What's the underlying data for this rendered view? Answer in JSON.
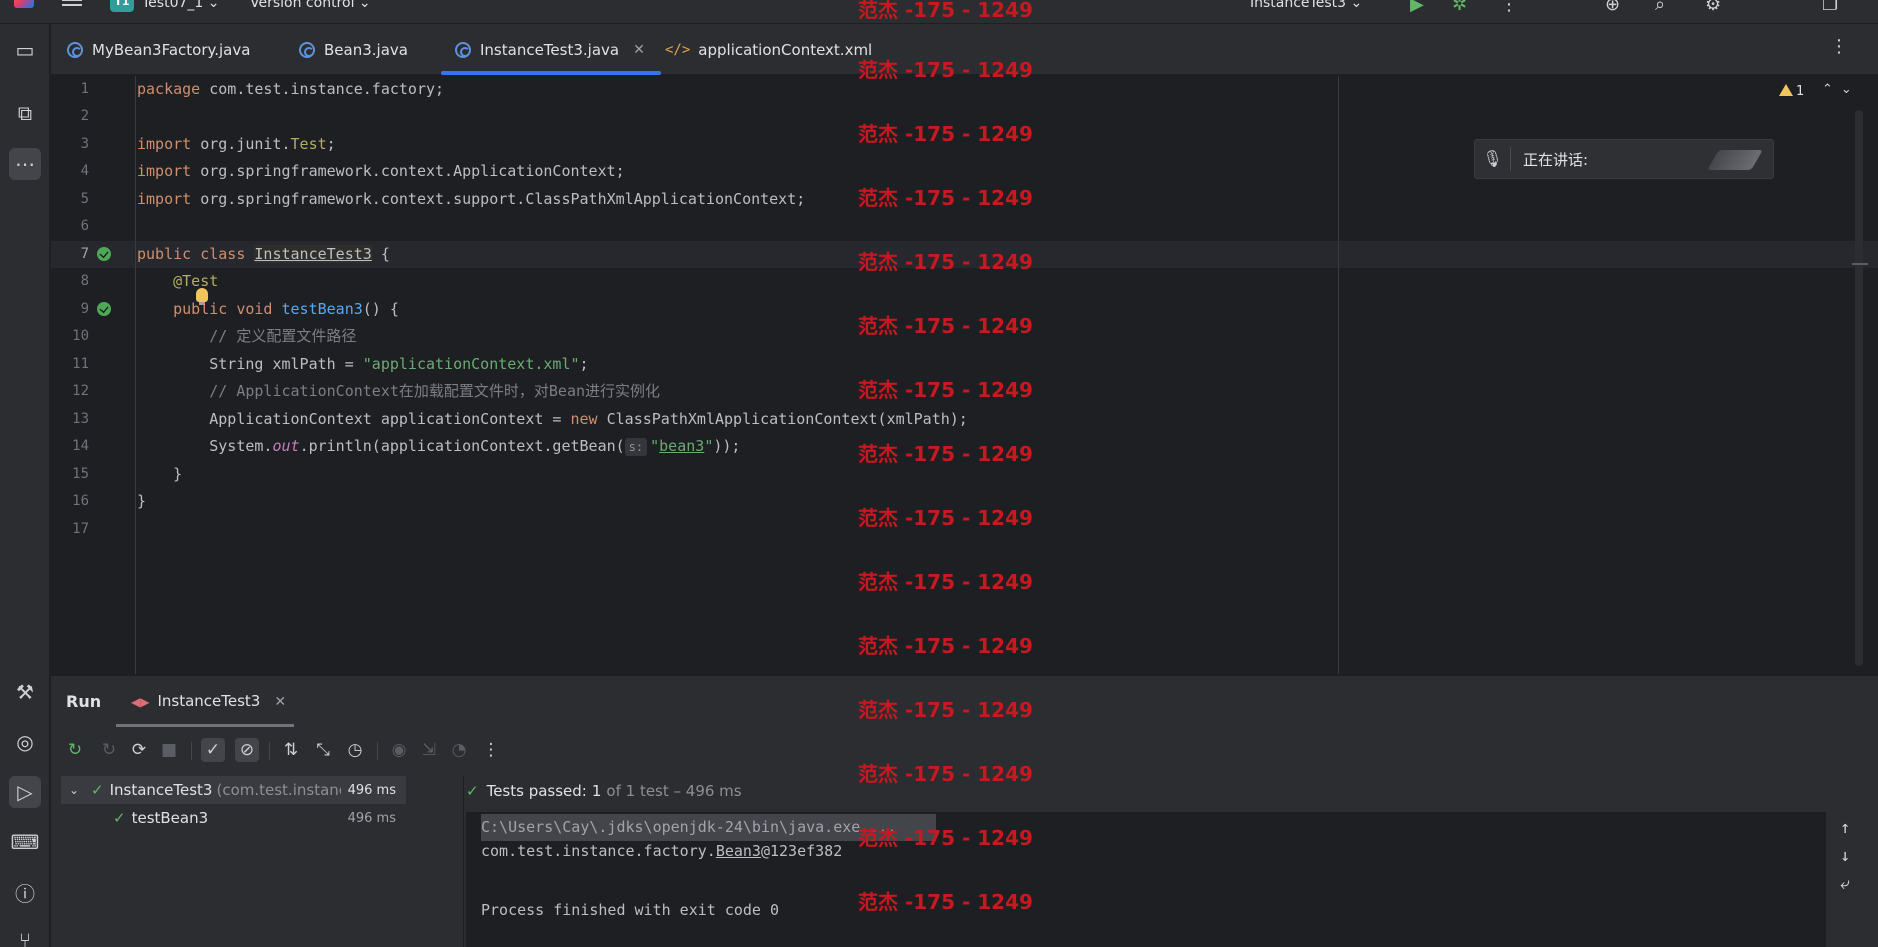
{
  "topbar": {
    "project_badge": "T1",
    "project_name": "Test07_1 ⌄",
    "vcs": "Version control ⌄",
    "run_config": "InstanceTest3 ⌄"
  },
  "tabs": [
    {
      "label": "MyBean3Factory.java"
    },
    {
      "label": "Bean3.java"
    },
    {
      "label": "InstanceTest3.java"
    },
    {
      "label": "applicationContext.xml"
    }
  ],
  "editor": {
    "line_numbers": [
      "1",
      "2",
      "3",
      "4",
      "5",
      "6",
      "7",
      "8",
      "9",
      "10",
      "11",
      "12",
      "13",
      "14",
      "15",
      "16",
      "17"
    ],
    "code": {
      "l1_kw": "package",
      "l1_rest": " com.test.instance.factory;",
      "l3_kw": "import",
      "l3_a": " org.junit.",
      "l3_b": "Test",
      "l3_c": ";",
      "l4_kw": "import",
      "l4_rest": " org.springframework.context.ApplicationContext;",
      "l5_kw": "import",
      "l5_rest": " org.springframework.context.support.ClassPathXmlApplicationContext;",
      "l7_kw": "public class",
      "l7_cls": "InstanceTest3",
      "l7_rest": " {",
      "l8_ann": "@Test",
      "l9_kw": "public void",
      "l9_fn": "testBean3",
      "l9_rest": "() {",
      "l10_cmt": "// 定义配置文件路径",
      "l11_a": "String xmlPath = ",
      "l11_str": "\"applicationContext.xml\"",
      "l11_b": ";",
      "l12_cmt": "// ApplicationContext在加载配置文件时，对Bean进行实例化",
      "l13_a": "ApplicationContext applicationContext = ",
      "l13_kw": "new",
      "l13_b": " ClassPathXmlApplicationContext(xmlPath);",
      "l14_a": "System.",
      "l14_st": "out",
      "l14_b": ".println(applicationContext.getBean(",
      "l14_hint": "s:",
      "l14_str_q1": "\"",
      "l14_str": "bean3",
      "l14_str_q2": "\"",
      "l14_c": "));",
      "l15": "}",
      "l16": "}"
    },
    "warnings_count": "1"
  },
  "speaking_popup": {
    "label": "正在讲话:"
  },
  "watermark": "范杰 -175 - 1249",
  "run_panel": {
    "title": "Run",
    "tab_label": "InstanceTest3",
    "tree": [
      {
        "name": "InstanceTest3",
        "package": "(com.test.instance.factory)",
        "time": "496 ms"
      },
      {
        "name": "testBean3",
        "time": "496 ms"
      }
    ],
    "result": {
      "prefix": "Tests passed:",
      "count": "1",
      "suffix": "of 1 test – 496 ms"
    },
    "console": {
      "cmd": "C:\\Users\\Cay\\.jdks\\openjdk-24\\bin\\java.exe ...",
      "output_a": "com.test.instance.factory.",
      "output_u": "Bean3",
      "output_b": "@123ef382",
      "finished": "Process finished with exit code 0"
    }
  },
  "colors": {
    "accent": "#3574f0",
    "pass": "#5fb865",
    "watermark": "#c8191e"
  }
}
